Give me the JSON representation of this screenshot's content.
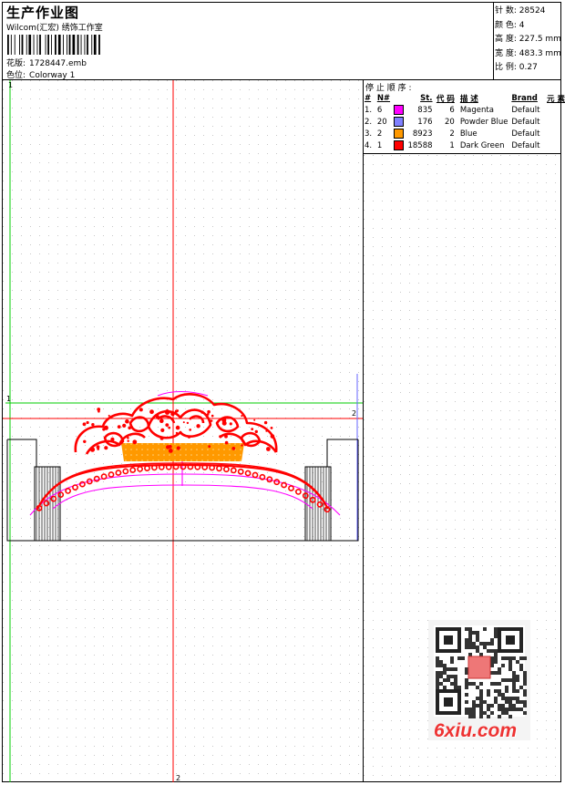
{
  "header": {
    "title": "生产作业图",
    "company": "Wilcom(汇宏) 绣饰工作室",
    "design_label": "花版:",
    "design_value": "1728447.emb",
    "colorway_label": "色位:",
    "colorway_value": "Colorway 1"
  },
  "stats": [
    {
      "label": "针 数:",
      "value": "28524"
    },
    {
      "label": "颜 色:",
      "value": "4"
    },
    {
      "label": "高 度:",
      "value": "227.5 mm"
    },
    {
      "label": "宽 度:",
      "value": "483.3 mm"
    },
    {
      "label": "比 例:",
      "value": "0.27"
    }
  ],
  "stop_sequence": {
    "title": "停 止 顺 序 :",
    "headers": {
      "num": "#",
      "n": "N#",
      "st": "St.",
      "code": "代 码",
      "desc": "描 述",
      "brand": "Brand",
      "element": "元 素"
    },
    "rows": [
      {
        "num": "1.",
        "n": "6",
        "color": "#ff00ff",
        "st": "835",
        "code": "6",
        "desc": "Magenta",
        "brand": "Default"
      },
      {
        "num": "2.",
        "n": "20",
        "color": "#8080ff",
        "st": "176",
        "code": "20",
        "desc": "Powder Blue",
        "brand": "Default"
      },
      {
        "num": "3.",
        "n": "2",
        "color": "#ff9900",
        "st": "8923",
        "code": "2",
        "desc": "Blue",
        "brand": "Default"
      },
      {
        "num": "4.",
        "n": "1",
        "color": "#ff0000",
        "st": "18588",
        "code": "1",
        "desc": "Dark Green",
        "brand": "Default"
      }
    ]
  },
  "design": {
    "marker_1_top": "1",
    "marker_1_mid": "1",
    "marker_2_right": "2",
    "marker_2_bottom": "2",
    "guide_green": "#00cc00",
    "guide_red": "#ff0000",
    "outline_blue": "#6666ff"
  },
  "watermark": {
    "text": "6xiu.com",
    "qr_icon": "qr-code-icon"
  }
}
